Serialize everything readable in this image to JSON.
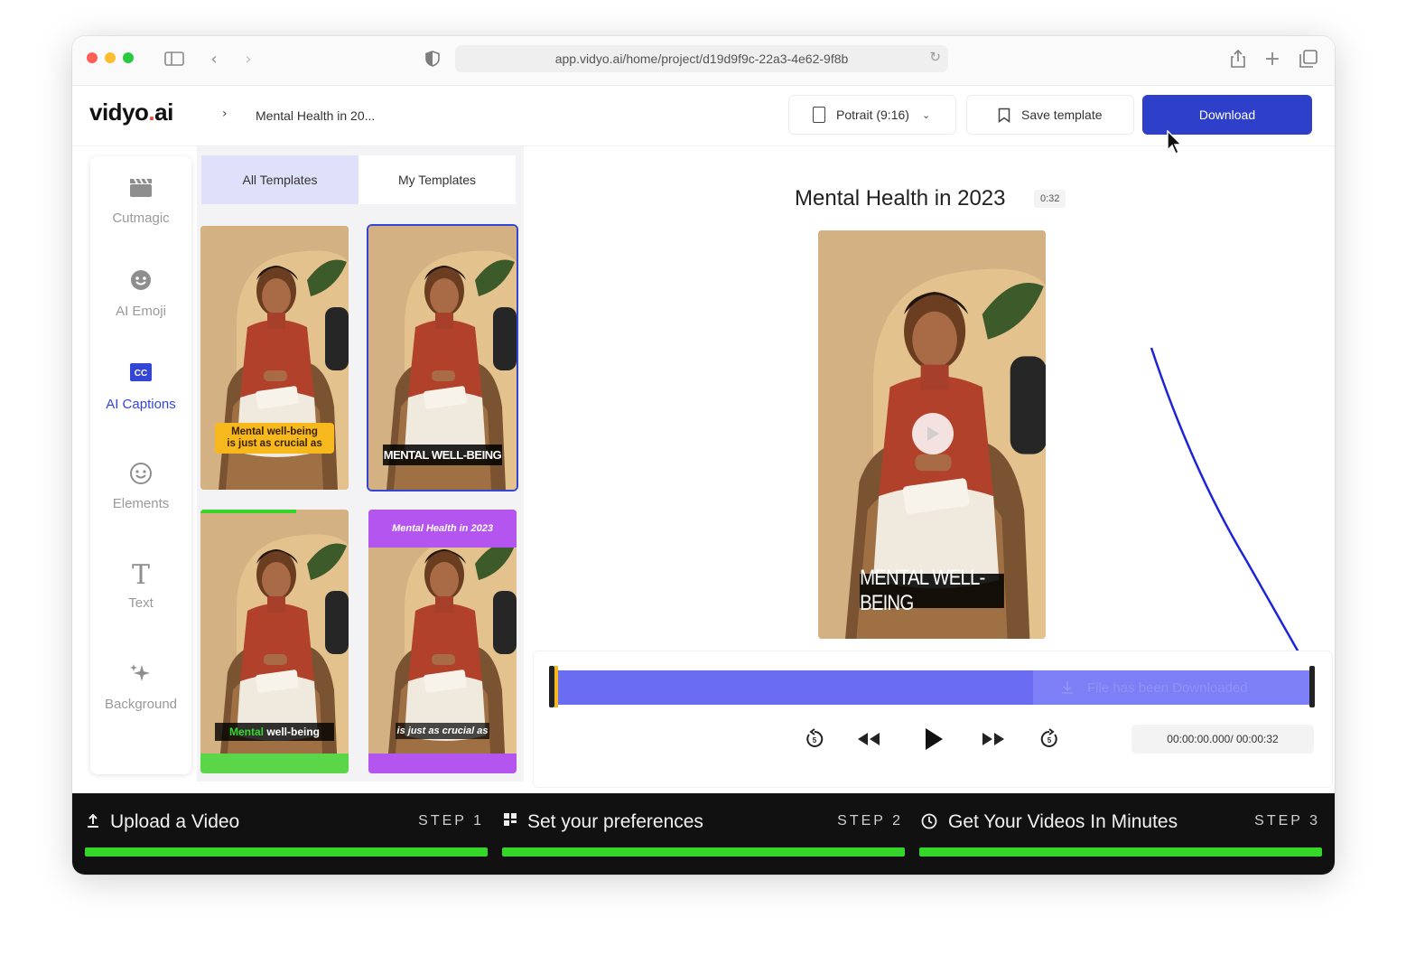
{
  "browser": {
    "url": "app.vidyo.ai/home/project/d19d9f9c-22a3-4e62-9f8b"
  },
  "header": {
    "logo_main": "vidyo",
    "logo_dot": ".",
    "logo_tld": "ai",
    "breadcrumb_sep": "›",
    "project_name": "Mental Health in 20...",
    "aspect_label": "Potrait (9:16)",
    "save_template_label": "Save template",
    "download_label": "Download"
  },
  "rail": {
    "items": [
      {
        "label": "Cutmagic",
        "icon": "clapperboard-icon"
      },
      {
        "label": "AI Emoji",
        "icon": "emoji-icon"
      },
      {
        "label": "AI Captions",
        "icon": "captions-icon",
        "active": true
      },
      {
        "label": "Elements",
        "icon": "smiley-icon"
      },
      {
        "label": "Text",
        "icon": "text-icon"
      },
      {
        "label": "Background",
        "icon": "sparkles-icon"
      }
    ]
  },
  "templates": {
    "tabs": [
      "All Templates",
      "My Templates"
    ],
    "active_tab": "All Templates",
    "items": [
      {
        "caption_line1": "Mental well-being",
        "caption_line2": "is just as crucial as"
      },
      {
        "caption": "MENTAL WELL-BEING"
      },
      {
        "caption_a": "Mental",
        "caption_b": " well-being"
      },
      {
        "header": "Mental Health in 2023",
        "caption": "is just as crucial as"
      }
    ]
  },
  "preview": {
    "title": "Mental Health in 2023",
    "duration": "0:32",
    "caption": "MENTAL WELL-BEING"
  },
  "timeline": {
    "status_text": "File has been Downloaded",
    "time_display": "00:00:00.000/ 00:00:32",
    "progress": 1.0
  },
  "steps": [
    {
      "title": "Upload a Video",
      "label": "STEP 1",
      "icon": "upload-icon"
    },
    {
      "title": "Set your preferences",
      "label": "STEP 2",
      "icon": "grid-icon"
    },
    {
      "title": "Get Your Videos In Minutes",
      "label": "STEP 3",
      "icon": "clock-icon"
    }
  ],
  "colors": {
    "accent": "#2e3fc9",
    "track": "#6a6df2",
    "step_bar": "#34d62a",
    "caption_yellow": "#f6b81c",
    "template_purple": "#b455f0"
  }
}
